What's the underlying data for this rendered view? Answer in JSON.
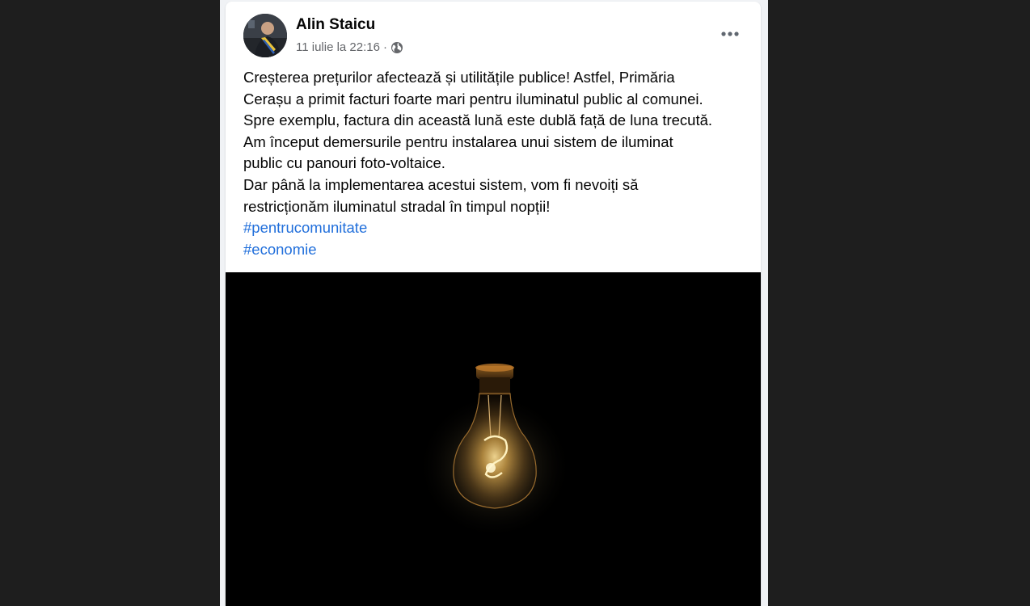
{
  "post": {
    "author": "Alin Staicu",
    "timestamp": "11 iulie la 22:16",
    "separator": "·",
    "privacy_icon": "globe-icon",
    "more_icon": "more-options-icon",
    "body_lines": [
      "Creșterea prețurilor afectează și utilitățile publice! Astfel, Primăria",
      "Cerașu a primit facturi foarte mari pentru iluminatul public al comunei.",
      "Spre exemplu, factura din această lună este dublă față de luna trecută.",
      "Am început demersurile pentru instalarea unui sistem de iluminat",
      "public cu panouri foto-voltaice.",
      "Dar până la implementarea acestui sistem, vom fi nevoiți să",
      "restricționăm iluminatul stradal în timpul nopții!"
    ],
    "hashtags": [
      "#pentrucomunitate",
      "#economie"
    ],
    "image_subject": "glowing-light-bulb"
  },
  "colors": {
    "page_bg": "#1e1e1e",
    "card_bg": "#ffffff",
    "text": "#050505",
    "meta_text": "#65676b",
    "hashtag": "#216fdb",
    "image_bg": "#000000"
  }
}
